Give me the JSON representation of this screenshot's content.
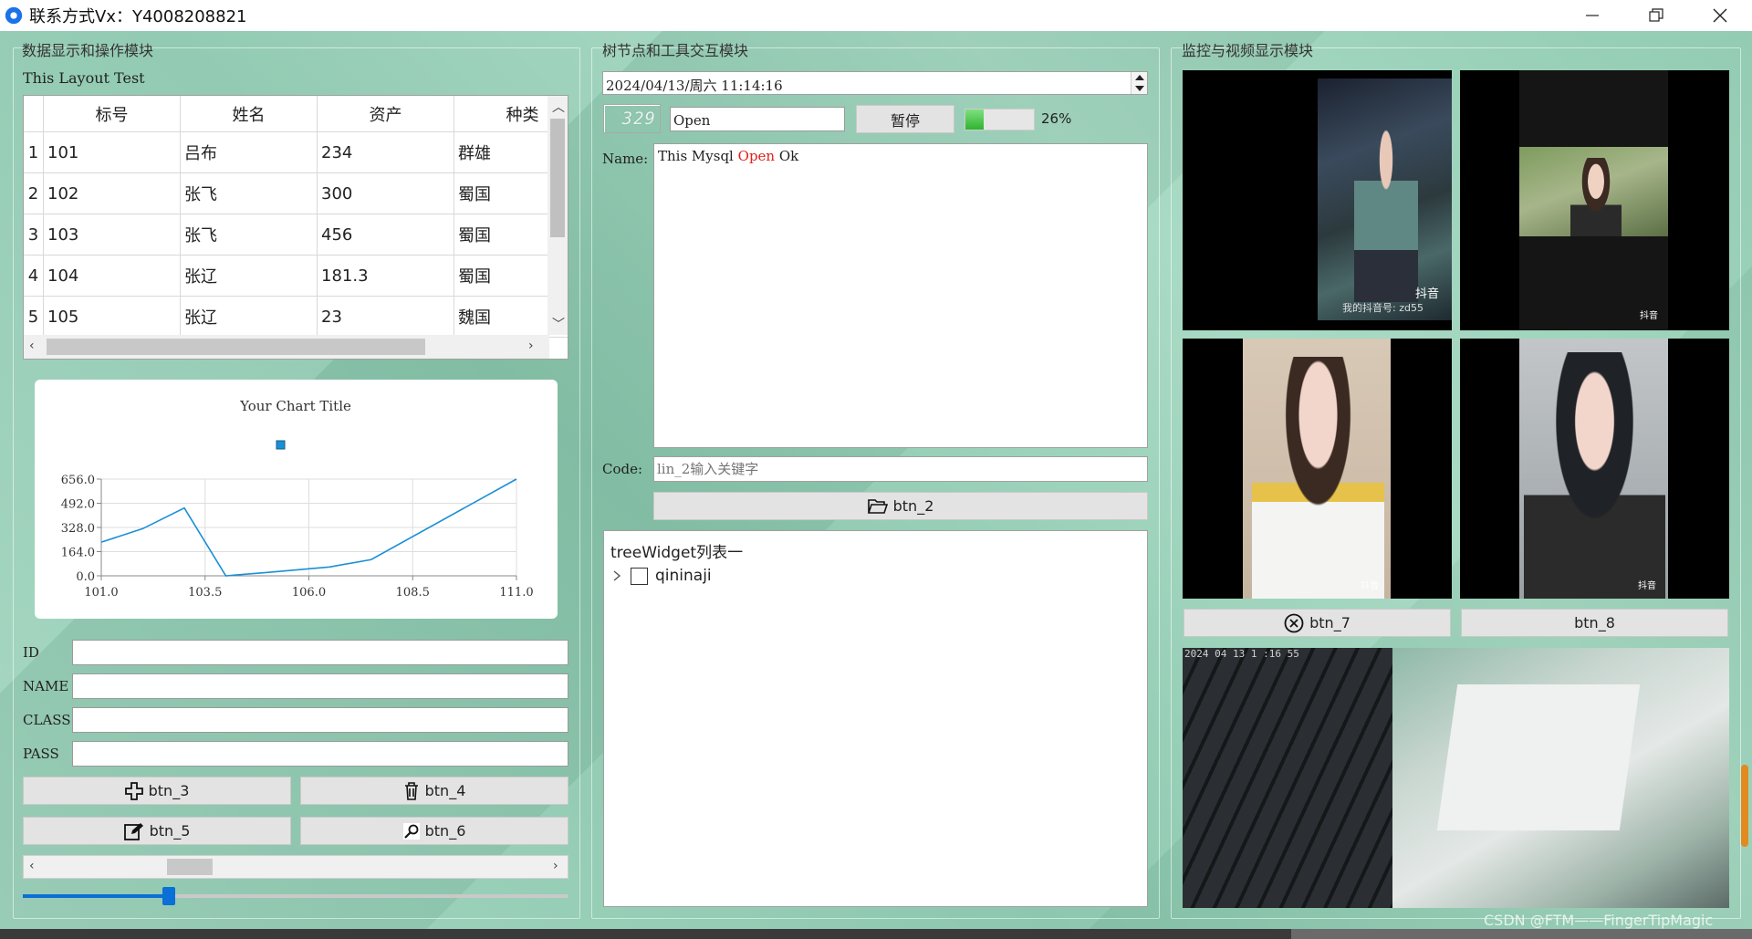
{
  "window": {
    "title": "联系方式Vx：Y4008208821",
    "controls": [
      "minimize",
      "restore",
      "close"
    ]
  },
  "left_panel": {
    "title": "数据显示和操作模块",
    "layout_label": "This Layout Test",
    "table": {
      "headers": [
        "标号",
        "姓名",
        "资产",
        "种类"
      ],
      "rows": [
        {
          "num": "1",
          "cells": [
            "101",
            "吕布",
            "234",
            "群雄"
          ]
        },
        {
          "num": "2",
          "cells": [
            "102",
            "张飞",
            "300",
            "蜀国"
          ]
        },
        {
          "num": "3",
          "cells": [
            "103",
            "张飞",
            "456",
            "蜀国"
          ]
        },
        {
          "num": "4",
          "cells": [
            "104",
            "张辽",
            "181.3",
            "蜀国"
          ]
        },
        {
          "num": "5",
          "cells": [
            "105",
            "张辽",
            "23",
            "魏国"
          ]
        }
      ]
    },
    "form": {
      "id_label": "ID",
      "id_value": "",
      "name_label": "NAME",
      "name_value": "",
      "class_label": "CLASS",
      "class_value": "",
      "pass_label": "PASS",
      "pass_value": ""
    },
    "buttons": {
      "btn_3": "btn_3",
      "btn_4": "btn_4",
      "btn_5": "btn_5",
      "btn_6": "btn_6"
    }
  },
  "chart_data": {
    "type": "line",
    "title": "Your Chart Title",
    "x": [
      101,
      102,
      103,
      104,
      105,
      106.5,
      107.5,
      111
    ],
    "y": [
      228,
      320,
      460,
      0,
      23,
      60,
      110,
      656
    ],
    "xlabel": "",
    "ylabel": "",
    "xlim": [
      101,
      111
    ],
    "ylim": [
      0,
      656
    ],
    "xticks": [
      "101.0",
      "103.5",
      "106.0",
      "108.5",
      "111.0"
    ],
    "yticks": [
      "0.0",
      "164.0",
      "328.0",
      "492.0",
      "656.0"
    ],
    "grid": true,
    "legend": "top-center",
    "line_color": "#1b8fd6"
  },
  "middle_panel": {
    "title": "树节点和工具交互模块",
    "datetime": "2024/04/13/周六 11:14:16",
    "lcd_value": "329",
    "open_field": "Open",
    "pause_button": "暂停",
    "progress_percent": 26,
    "progress_label": "26%",
    "name_label": "Name:",
    "name_text": {
      "part1": "This Mysql ",
      "highlight": "Open",
      "part2": " Ok"
    },
    "code_label": "Code:",
    "code_placeholder": "lin_2输入关键字",
    "btn_2": "btn_2",
    "tree": {
      "header": "treeWidget列表一",
      "items": [
        {
          "label": "qininaji",
          "checked": false
        }
      ]
    }
  },
  "right_panel": {
    "title": "监控与视频显示模块",
    "btn_7": "btn_7",
    "btn_8": "btn_8",
    "video1_caption": "我的抖音号: zd55",
    "video_brand": "抖音",
    "camera_timestamp": "2024 04 13 1 :16 55"
  },
  "watermark": "CSDN @FTM——FingerTipMagic"
}
